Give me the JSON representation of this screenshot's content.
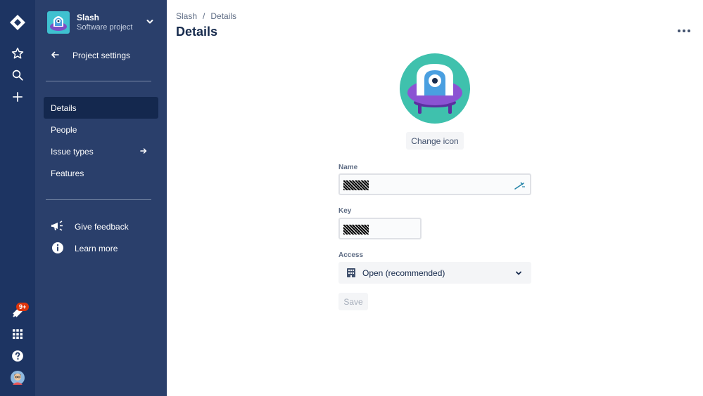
{
  "global_nav": {
    "notification_badge": "9+"
  },
  "project": {
    "name": "Slash",
    "type": "Software project"
  },
  "sidebar": {
    "back_label": "Project settings",
    "items": [
      {
        "label": "Details",
        "active": true
      },
      {
        "label": "People",
        "active": false
      },
      {
        "label": "Issue types",
        "active": false
      },
      {
        "label": "Features",
        "active": false
      }
    ],
    "footer": [
      {
        "label": "Give feedback",
        "icon": "megaphone-icon"
      },
      {
        "label": "Learn more",
        "icon": "info-icon"
      }
    ]
  },
  "breadcrumb": {
    "project": "Slash",
    "current": "Details"
  },
  "page": {
    "title": "Details",
    "change_icon_label": "Change icon"
  },
  "form": {
    "name_label": "Name",
    "name_value": "",
    "key_label": "Key",
    "key_value": "",
    "access_label": "Access",
    "access_value": "Open (recommended)",
    "save_label": "Save"
  },
  "colors": {
    "global_nav": "#1d3462",
    "sidebar": "#2a3f6b",
    "sidebar_active": "#14284e",
    "badge": "#de350b",
    "avatar_bg": "#3fc1ad"
  }
}
